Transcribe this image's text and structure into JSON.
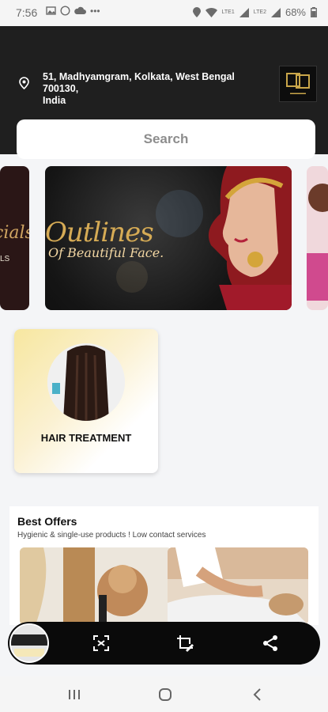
{
  "status_bar": {
    "time": "7:56",
    "battery": "68%",
    "network_label_1": "LTE1",
    "network_label_2": "LTE2"
  },
  "header": {
    "address_line1": "51, Madhyamgram, Kolkata, West Bengal 700130,",
    "address_line2": "India",
    "search_placeholder": "Search"
  },
  "banners": {
    "left_text": "cials",
    "left_sub": "LS",
    "main_title": "Outlines",
    "main_subtitle": "Of Beautiful Face."
  },
  "services": [
    {
      "label": "HAIR TREATMENT"
    }
  ],
  "best_offers": {
    "title": "Best Offers",
    "subtitle": "Hygienic & single-use products ! Low contact services"
  },
  "icons": {
    "location": "location-pin-icon",
    "scan": "scan-icon",
    "crop": "crop-edit-icon",
    "share": "share-icon"
  }
}
